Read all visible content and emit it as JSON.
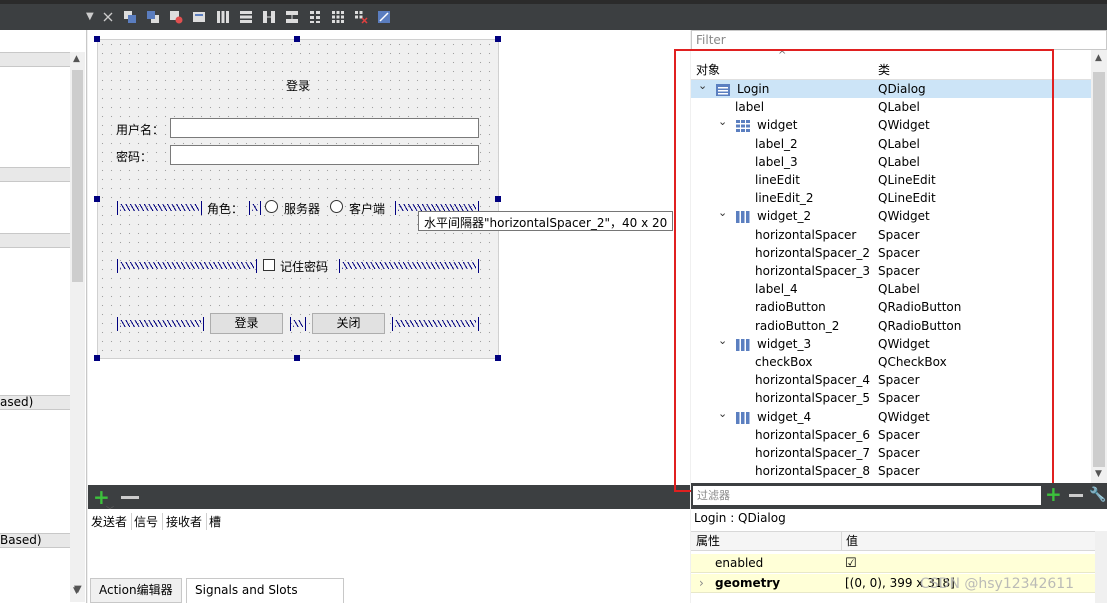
{
  "toolbar": {
    "icons": [
      "close-x-icon",
      "send-to-back-icon",
      "bring-to-front-icon",
      "edit-tab-order-icon",
      "edit-buddies-icon",
      "lay-out-horizontally-icon",
      "lay-out-vertically-icon",
      "splitter-horizontal-icon",
      "splitter-vertical-icon",
      "lay-out-in-form-icon",
      "lay-out-in-grid-icon",
      "break-layout-icon",
      "adjust-size-icon"
    ]
  },
  "left_panel": {
    "headers": [
      "",
      "",
      "",
      "ased)",
      "Based)"
    ]
  },
  "form": {
    "title": "登录",
    "username_label": "用户名：",
    "password_label": "密码：",
    "role_label": "角色：",
    "radio_server": "服务器",
    "radio_client": "客户端",
    "remember_label": "记住密码",
    "login_button": "登录",
    "close_button": "关闭",
    "tooltip": "水平间隔器\"horizontalSpacer_2\"，40 x 20"
  },
  "signals": {
    "columns": [
      "发送者",
      "信号",
      "接收者",
      "槽"
    ],
    "tabs": [
      "Action编辑器",
      "Signals and Slots Editor"
    ]
  },
  "inspector": {
    "filter_placeholder": "Filter",
    "col_object": "对象",
    "col_class": "类",
    "rows": [
      {
        "name": "Login",
        "cls": "QDialog"
      },
      {
        "name": "label",
        "cls": "QLabel"
      },
      {
        "name": "widget",
        "cls": "QWidget"
      },
      {
        "name": "label_2",
        "cls": "QLabel"
      },
      {
        "name": "label_3",
        "cls": "QLabel"
      },
      {
        "name": "lineEdit",
        "cls": "QLineEdit"
      },
      {
        "name": "lineEdit_2",
        "cls": "QLineEdit"
      },
      {
        "name": "widget_2",
        "cls": "QWidget"
      },
      {
        "name": "horizontalSpacer",
        "cls": "Spacer"
      },
      {
        "name": "horizontalSpacer_2",
        "cls": "Spacer"
      },
      {
        "name": "horizontalSpacer_3",
        "cls": "Spacer"
      },
      {
        "name": "label_4",
        "cls": "QLabel"
      },
      {
        "name": "radioButton",
        "cls": "QRadioButton"
      },
      {
        "name": "radioButton_2",
        "cls": "QRadioButton"
      },
      {
        "name": "widget_3",
        "cls": "QWidget"
      },
      {
        "name": "checkBox",
        "cls": "QCheckBox"
      },
      {
        "name": "horizontalSpacer_4",
        "cls": "Spacer"
      },
      {
        "name": "horizontalSpacer_5",
        "cls": "Spacer"
      },
      {
        "name": "widget_4",
        "cls": "QWidget"
      },
      {
        "name": "horizontalSpacer_6",
        "cls": "Spacer"
      },
      {
        "name": "horizontalSpacer_7",
        "cls": "Spacer"
      },
      {
        "name": "horizontalSpacer_8",
        "cls": "Spacer"
      }
    ]
  },
  "properties": {
    "filter_placeholder": "过滤器",
    "title": "Login : QDialog",
    "col_property": "属性",
    "col_value": "值",
    "rows": [
      {
        "name": "enabled",
        "value": "☑"
      },
      {
        "name": "geometry",
        "value": "[(0, 0), 399 x 318]"
      }
    ]
  },
  "watermark": "CSDN @hsy12342611",
  "colors": {
    "selection": "#cce4f7",
    "spacer": "#00007f",
    "highlight_box": "#e02020",
    "dark_toolbar": "#3c3f41"
  }
}
